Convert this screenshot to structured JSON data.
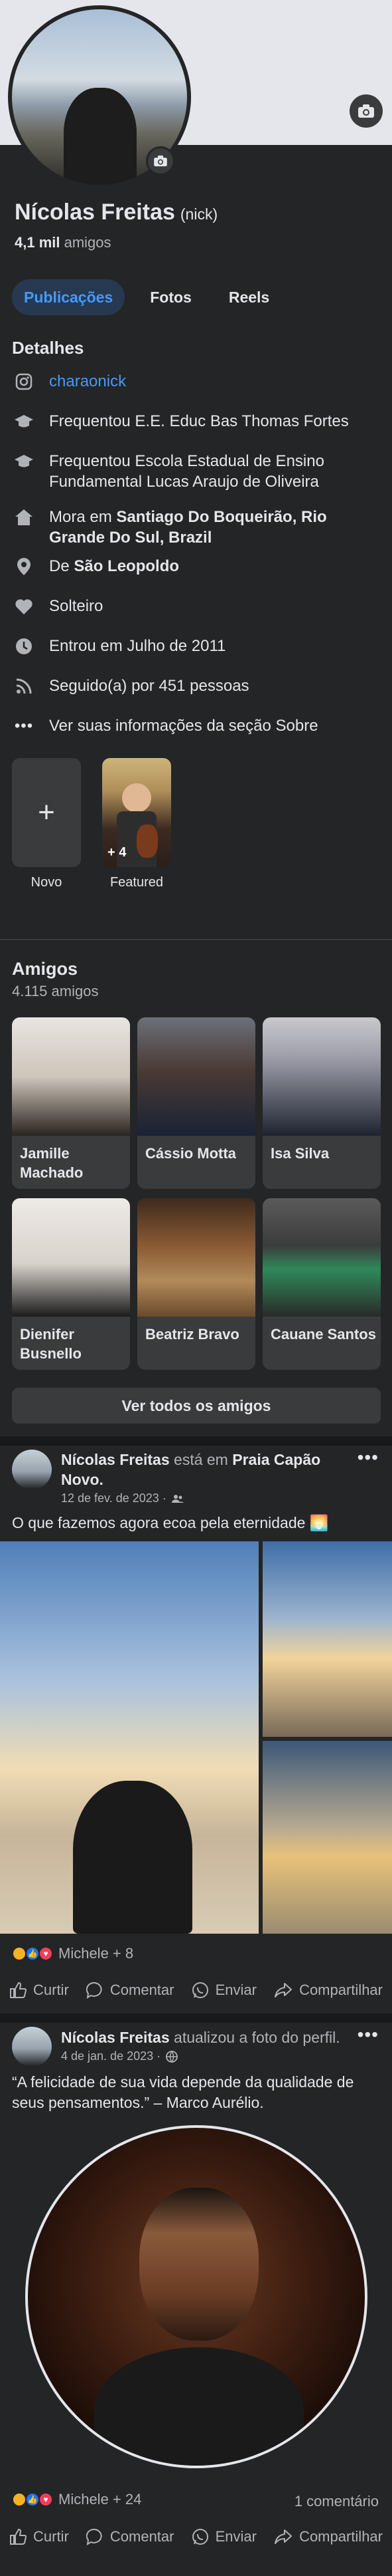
{
  "profile": {
    "name": "Nícolas Freitas",
    "nickname": "(nick)",
    "friends_count": "4,1 mil",
    "friends_label": "amigos"
  },
  "tabs": [
    {
      "label": "Publicações",
      "active": true
    },
    {
      "label": "Fotos",
      "active": false
    },
    {
      "label": "Reels",
      "active": false
    }
  ],
  "details": {
    "title": "Detalhes",
    "instagram": "charaonick",
    "studied_1": "Frequentou E.E. Educ Bas Thomas Fortes",
    "studied_2": "Frequentou Escola Estadual de Ensino Fundamental Lucas Araujo de Oliveira",
    "lives_prefix": "Mora em",
    "lives_place": "Santiago Do Boqueirão, Rio Grande Do Sul, Brazil",
    "from_prefix": "De",
    "from_place": "São Leopoldo",
    "relationship": "Solteiro",
    "joined": "Entrou em Julho de 2011",
    "followers": "Seguido(a) por 451 pessoas",
    "about": "Ver suas informações da seção Sobre"
  },
  "highlights": {
    "new_label": "Novo",
    "featured_label": "Featured",
    "featured_badge": "+ 4"
  },
  "friends": {
    "title": "Amigos",
    "count": "4.115 amigos",
    "list": [
      {
        "name": "Jamille Machado"
      },
      {
        "name": "Cássio Motta"
      },
      {
        "name": "Isa Silva"
      },
      {
        "name": "Dienifer Busnello"
      },
      {
        "name": "Beatriz Bravo"
      },
      {
        "name": "Cauane Santos"
      }
    ],
    "see_all": "Ver todos os amigos"
  },
  "post1": {
    "author": "Nícolas Freitas",
    "verb": "está em",
    "place": "Praia Capão Novo.",
    "date": "12 de fev. de 2023 ·",
    "text": "O que fazemos agora ecoa pela eternidade 🌅",
    "reactions": "Michele + 8"
  },
  "post2": {
    "author": "Nícolas Freitas",
    "verb": "atualizou a foto do perfil.",
    "date": "4 de jan. de 2023 ·",
    "text": "“A felicidade de sua vida depende da qualidade de seus pensamentos.” – Marco Aurélio.",
    "reactions": "Michele + 24",
    "comments": "1 comentário"
  },
  "actions": {
    "like": "Curtir",
    "comment": "Comentar",
    "send": "Enviar",
    "share": "Compartilhar"
  },
  "colors": {
    "background": "#242526",
    "accent": "#4599ff",
    "tab_active_bg": "#263951",
    "muted": "#b0b3b8"
  }
}
